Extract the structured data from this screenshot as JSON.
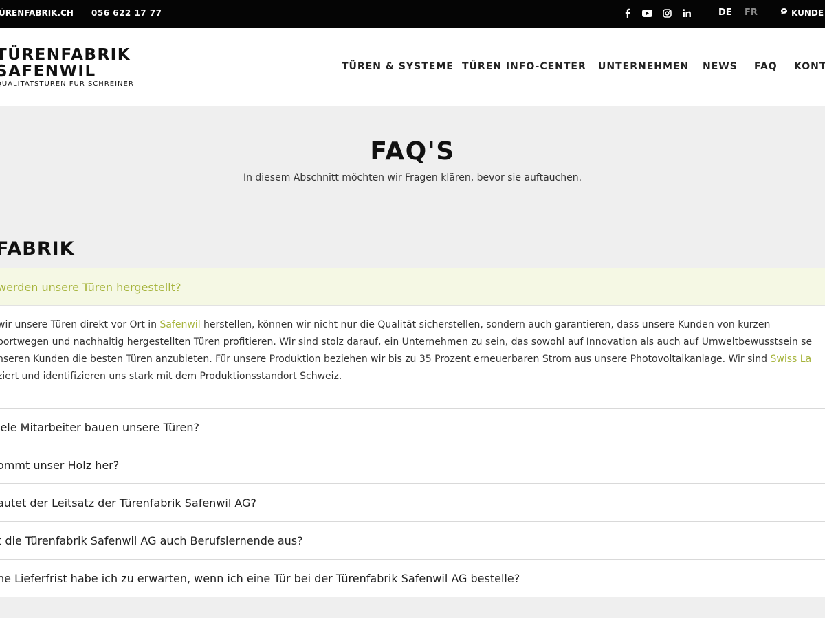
{
  "topbar": {
    "email": "ÜRENFABRIK.CH",
    "phone": "056 622 17 77",
    "social": [
      "facebook-icon",
      "youtube-icon",
      "instagram-icon",
      "linkedin-icon"
    ],
    "lang_de": "DE",
    "lang_fr": "FR",
    "kunde": "KUNDE"
  },
  "logo": {
    "line1": "TÜRENFABRIK",
    "line2": "SAFENWIL",
    "tagline": "QUALITÄTSTÜREN FÜR SCHREINER"
  },
  "nav": [
    "TÜREN & SYSTEME",
    "TÜREN INFO-CENTER",
    "UNTERNEHMEN",
    "NEWS",
    "FAQ",
    "KONT"
  ],
  "hero": {
    "title": "FAQ'S",
    "subtitle": "In diesem Abschnitt möchten wir Fragen klären, bevor sie auftauchen."
  },
  "section_title": "FABRIK",
  "faq": {
    "active_question": "werden unsere Türen hergestellt?",
    "answer": {
      "l1_pre": "wir unsere Türen direkt vor Ort in ",
      "l1_link": "Safenwil",
      "l1_post": " herstellen, können wir nicht nur die Qualität sicherstellen, sondern auch garantieren, dass unsere Kunden von kurzen",
      "l2": "portwegen und nachhaltig hergestellten Türen profitieren. Wir sind stolz darauf, ein Unternehmen zu sein, das sowohl auf Innovation als auch auf Umweltbewusstsein se",
      "l3_pre": "nseren Kunden die besten Türen anzubieten. Für unsere Produktion beziehen wir bis zu 35 Prozent erneuerbaren Strom aus unsere Photovoltaikanlage. Wir sind ",
      "l3_link": "Swiss La",
      "l4": "ziert und identifizieren uns stark mit dem Produktionsstandort Schweiz."
    },
    "questions": [
      "iele Mitarbeiter bauen unsere Türen?",
      "ommt unser Holz her?",
      "autet der Leitsatz der Türenfabrik Safenwil AG?",
      "t die Türenfabrik Safenwil AG auch Berufslernende aus?",
      "he Lieferfrist habe ich zu erwarten, wenn ich eine Tür bei der Türenfabrik Safenwil AG bestelle?"
    ]
  },
  "colors": {
    "accent": "#a6b43c",
    "topbar_bg": "#050505",
    "page_bg": "#efefef"
  }
}
